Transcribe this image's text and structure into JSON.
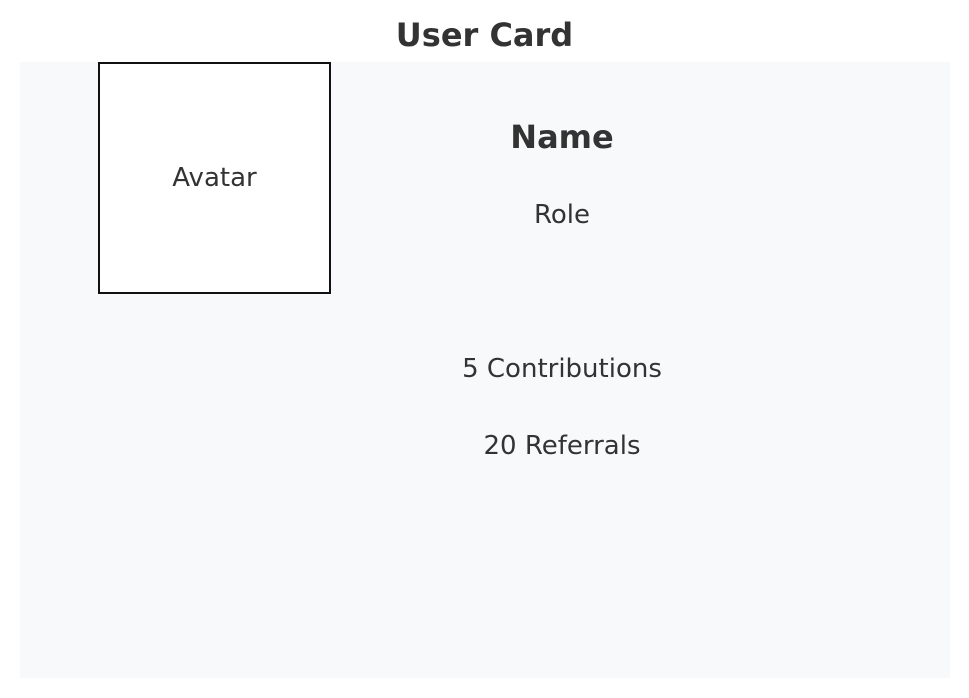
{
  "title": "User Card",
  "avatar": {
    "label": "Avatar"
  },
  "profile": {
    "name": "Name",
    "role": "Role"
  },
  "stats": {
    "contributions": "5 Contributions",
    "referrals": "20 Referrals"
  },
  "colors": {
    "card_background": "#f8f9fb",
    "text": "#333333",
    "avatar_border": "#111111"
  }
}
